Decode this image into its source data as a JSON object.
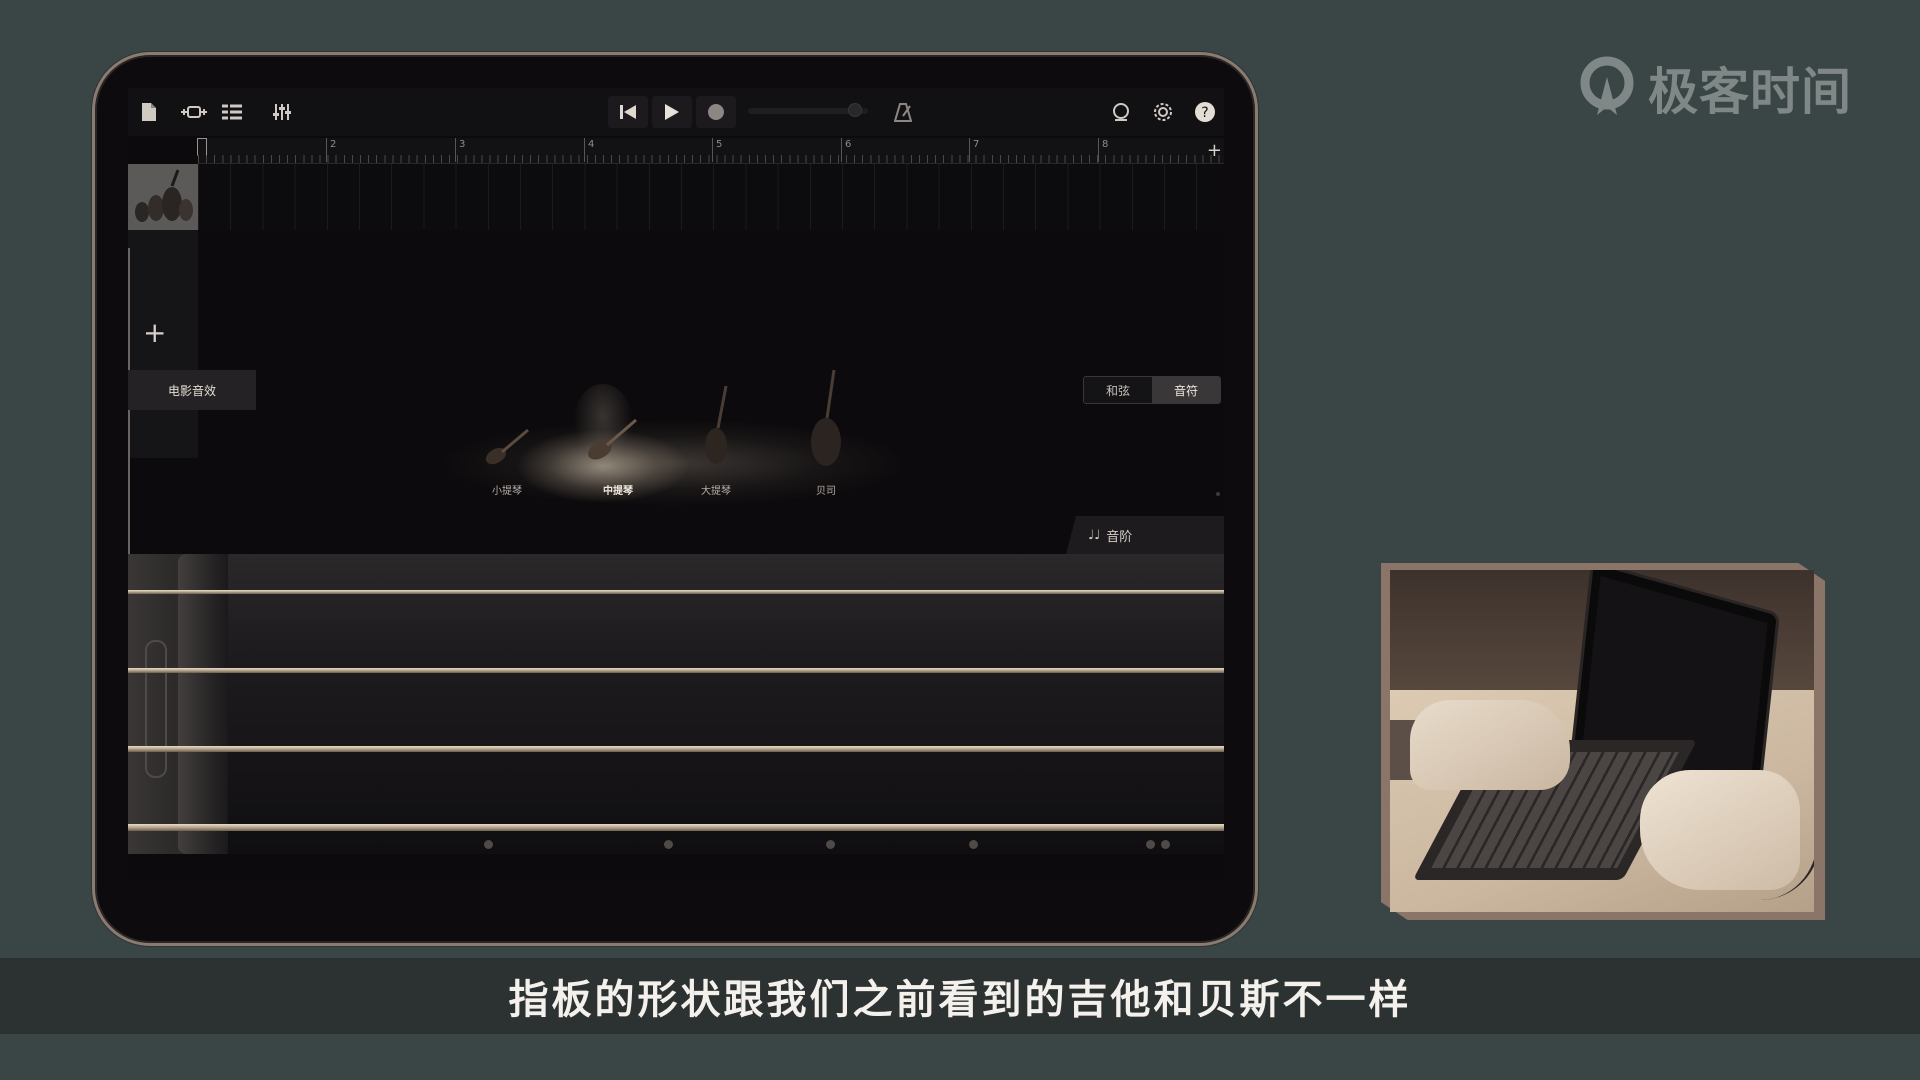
{
  "brand": {
    "name": "极客时间"
  },
  "toolbar": {
    "icons": [
      "document-icon",
      "track-view-icon",
      "tracks-list-icon",
      "mixer-icon",
      "rewind-icon",
      "play-icon",
      "record-icon",
      "metronome-icon",
      "loop-icon",
      "settings-icon",
      "help-icon"
    ]
  },
  "ruler": {
    "numbers": [
      "2",
      "3",
      "4",
      "5",
      "6",
      "7",
      "8"
    ]
  },
  "panel": {
    "sound_button": "电影音效",
    "segments": {
      "chords": "和弦",
      "notes": "音符"
    },
    "active_segment": "notes"
  },
  "instruments": [
    {
      "label": "小提琴",
      "active": false
    },
    {
      "label": "中提琴",
      "active": true
    },
    {
      "label": "大提琴",
      "active": false
    },
    {
      "label": "贝司",
      "active": false
    }
  ],
  "scale_tab": {
    "label": "音阶"
  },
  "subtitle": {
    "text": "指板的形状跟我们之前看到的吉他和贝斯不一样"
  },
  "colors": {
    "background": "#3a4546",
    "accent": "#e9dcc6",
    "subtitle_bar": "#2c3132"
  }
}
